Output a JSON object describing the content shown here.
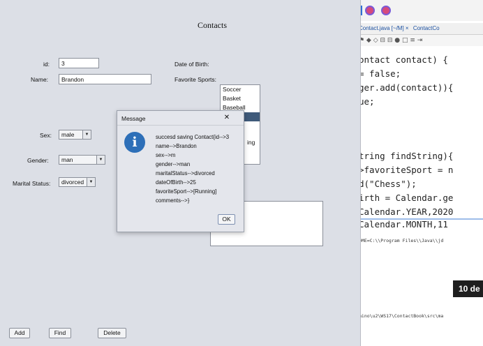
{
  "ide": {
    "tabs": [
      "Contact.java [~/M] ×",
      "ContactCo"
    ],
    "toolbar": "⚑ ◆ ◇  ⊟ ⊟  ● □  ≡ ⇥",
    "code_lines": [
      "ontact contact) {",
      "= false;",
      "ger.add(contact)){",
      "ue;",
      "",
      "",
      "tring findString){",
      ">favoriteSport = n",
      "d(\"Chess\");",
      "irth = Calendar.ge",
      "Calendar.YEAR,2020",
      "Calendar.MONTH,11"
    ],
    "console_lines": [
      "OME=C:\\\\Program Files\\\\Java\\\\jd",
      "mino\\u2\\WS17\\ContactBook\\src\\ma"
    ],
    "notification": "10 de"
  },
  "app": {
    "title": "Contacts",
    "id_label": "id:",
    "id_value": "3",
    "name_label": "Name:",
    "name_value": "Brandon",
    "dob_label": "Date of Birth:",
    "fav_label": "Favorite Sports:",
    "sports": [
      "Soccer",
      "Basket",
      "Baseball",
      "Running"
    ],
    "selected_sport_index": 3,
    "sex_label": "Sex:",
    "sex_value": "male",
    "gender_label": "Gender:",
    "gender_value": "man",
    "marital_label": "Marital Status:",
    "marital_value": "divorced",
    "buttons": {
      "add": "Add",
      "find": "Find",
      "delete": "Delete"
    },
    "list_peek": "ing"
  },
  "dialog": {
    "title": "Message",
    "close": "✕",
    "icon_letter": "i",
    "lines": [
      "succesd saving Contact{id-->3",
      "name-->Brandon",
      "sex-->m",
      "gender-->man",
      "maritalStatus-->divorced",
      "dateOfBirth-->25",
      "favoriteSport-->[Running]",
      " comments-->}"
    ],
    "ok": "OK"
  }
}
